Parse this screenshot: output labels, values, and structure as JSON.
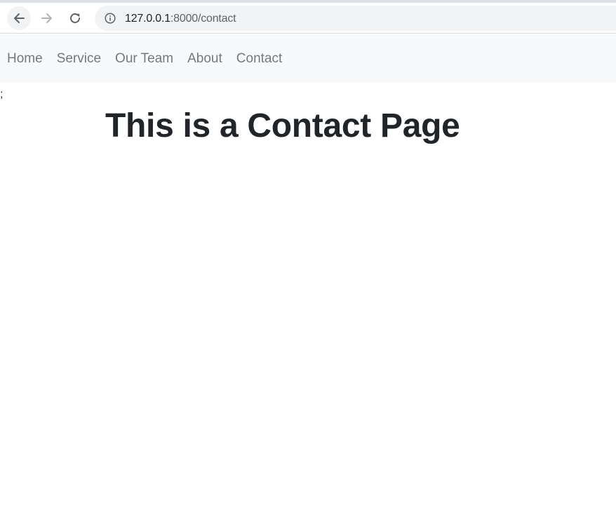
{
  "browser": {
    "url_host": "127.0.0.1",
    "url_path": ":8000/contact",
    "icons": {
      "back": "back-arrow-icon",
      "forward": "forward-arrow-icon",
      "reload": "reload-icon",
      "site_info": "info-icon"
    }
  },
  "navbar": {
    "items": [
      {
        "label": "Home"
      },
      {
        "label": "Service"
      },
      {
        "label": "Our Team"
      },
      {
        "label": "About"
      },
      {
        "label": "Contact"
      }
    ]
  },
  "page": {
    "stray_text": ";",
    "heading": "This is a Contact Page"
  },
  "colors": {
    "nav_background": "#f8f9fa",
    "nav_link": "#75787c",
    "heading": "#212529"
  }
}
